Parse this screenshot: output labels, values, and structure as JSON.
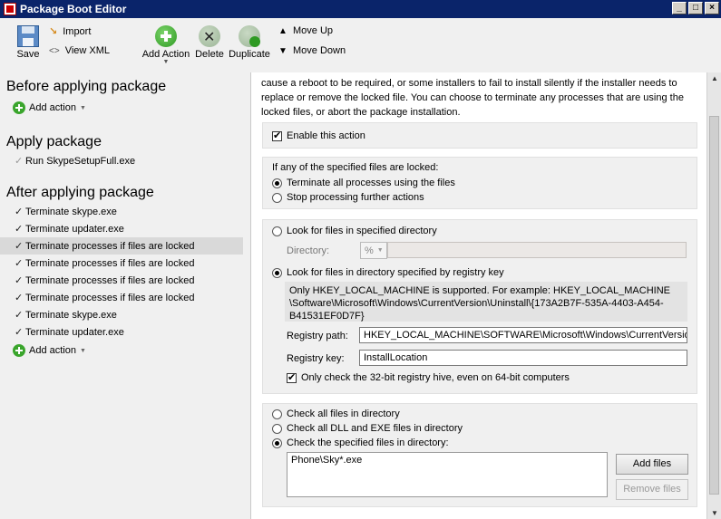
{
  "window": {
    "title": "Package Boot Editor"
  },
  "toolbar": {
    "save_label": "Save",
    "import_label": "Import",
    "view_xml_label": "View XML",
    "add_action_label": "Add Action",
    "delete_label": "Delete",
    "duplicate_label": "Duplicate",
    "move_up_label": "Move Up",
    "move_down_label": "Move Down"
  },
  "left": {
    "before_heading": "Before applying package",
    "add_action_label": "Add action",
    "apply_heading": "Apply package",
    "apply_item": "Run SkypeSetupFull.exe",
    "after_heading": "After applying package",
    "after_items": [
      "Terminate skype.exe",
      "Terminate updater.exe",
      "Terminate processes if files are locked",
      "Terminate processes if files are locked",
      "Terminate processes if files are locked",
      "Terminate processes if files are locked",
      "Terminate skype.exe",
      "Terminate updater.exe"
    ],
    "selected_index": 2
  },
  "right": {
    "intro_lines": [
      "cause a reboot to be required, or some installers to fail to install silently if the installer needs to",
      "replace or remove the locked file. You can choose to terminate any processes that are using the",
      "locked files, or abort the package installation."
    ],
    "enable_label": "Enable this action",
    "enable_checked": true,
    "locked_prompt": "If any of the specified files are locked:",
    "opt_terminate": "Terminate all processes using the files",
    "opt_stop": "Stop processing further actions",
    "look_dir_label": "Look for files in specified directory",
    "directory_label": "Directory:",
    "directory_combo": "%",
    "look_reg_label": "Look for files in directory specified by registry key",
    "reg_info_lines": [
      "Only HKEY_LOCAL_MACHINE is supported. For example: HKEY_LOCAL_MACHINE",
      "\\Software\\Microsoft\\Windows\\CurrentVersion\\Uninstall\\{173A2B7F-535A-4403-A454-",
      "B41531EF0D7F}"
    ],
    "reg_path_label": "Registry path:",
    "reg_path_value": "HKEY_LOCAL_MACHINE\\SOFTWARE\\Microsoft\\Windows\\CurrentVersion\\U",
    "reg_key_label": "Registry key:",
    "reg_key_value": "InstallLocation",
    "only32_label": "Only check the 32-bit registry hive, even on 64-bit computers",
    "only32_checked": true,
    "check_all_label": "Check all files in directory",
    "check_dll_label": "Check all DLL and EXE files in directory",
    "check_specified_label": "Check the specified files in directory:",
    "files_list": [
      "Phone\\Sky*.exe"
    ],
    "add_files_label": "Add files",
    "remove_files_label": "Remove files"
  }
}
